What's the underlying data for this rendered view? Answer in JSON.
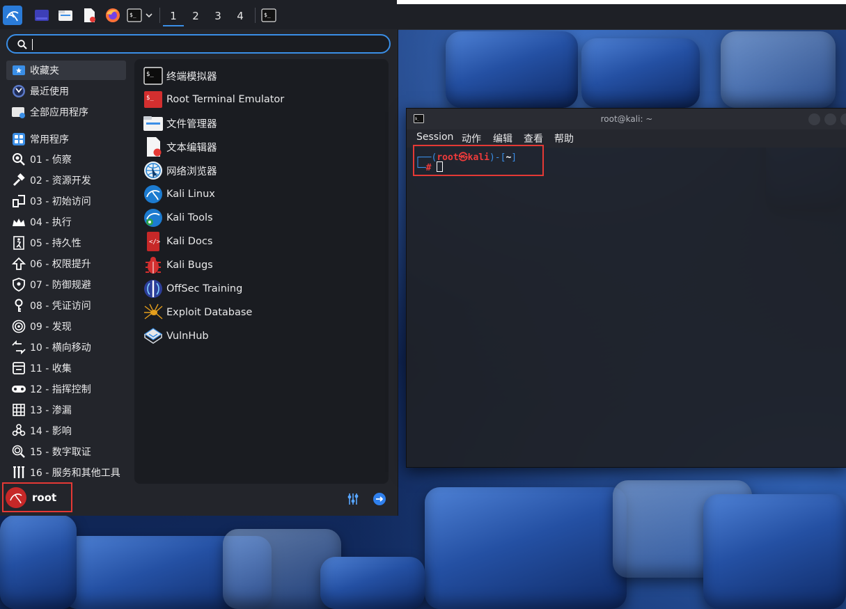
{
  "panel": {
    "workspaces": [
      "1",
      "2",
      "3",
      "4"
    ],
    "active_workspace": "1"
  },
  "menu": {
    "search": {
      "value": "",
      "placeholder": ""
    },
    "categories": [
      {
        "label": "收藏夹",
        "icon": "star-folder-icon"
      },
      {
        "label": "最近使用",
        "icon": "clock-icon"
      },
      {
        "label": "全部应用程序",
        "icon": "apps-folder-icon"
      },
      {
        "label": "常用程序",
        "icon": "grid-icon"
      },
      {
        "label": "01 - 侦察",
        "icon": "magnifier-icon"
      },
      {
        "label": "02 - 资源开发",
        "icon": "hammer-icon"
      },
      {
        "label": "03 - 初始访问",
        "icon": "door-icon"
      },
      {
        "label": "04 - 执行",
        "icon": "crown-icon"
      },
      {
        "label": "05 - 持久性",
        "icon": "runner-icon"
      },
      {
        "label": "06 - 权限提升",
        "icon": "arrow-up-icon"
      },
      {
        "label": "07 - 防御规避",
        "icon": "shield-icon"
      },
      {
        "label": "08 - 凭证访问",
        "icon": "key-icon"
      },
      {
        "label": "09 - 发现",
        "icon": "radar-icon"
      },
      {
        "label": "10 - 横向移动",
        "icon": "arrows-horizontal-icon"
      },
      {
        "label": "11 - 收集",
        "icon": "archive-icon"
      },
      {
        "label": "12 - 指挥控制",
        "icon": "gamepad-icon"
      },
      {
        "label": "13 - 渗漏",
        "icon": "exfil-icon"
      },
      {
        "label": "14 - 影响",
        "icon": "biohazard-icon"
      },
      {
        "label": "15 - 数字取证",
        "icon": "fingerprint-icon"
      },
      {
        "label": "16 - 服务和其他工具",
        "icon": "tools-icon"
      }
    ],
    "apps": [
      {
        "label": "终端模拟器",
        "icon": "terminal-icon"
      },
      {
        "label": "Root Terminal Emulator",
        "icon": "root-terminal-icon"
      },
      {
        "label": "文件管理器",
        "icon": "folder-icon"
      },
      {
        "label": "文本编辑器",
        "icon": "text-editor-icon"
      },
      {
        "label": "网络浏览器",
        "icon": "web-browser-icon"
      },
      {
        "label": "Kali Linux",
        "icon": "kali-dragon-icon"
      },
      {
        "label": "Kali Tools",
        "icon": "kali-tools-icon"
      },
      {
        "label": "Kali Docs",
        "icon": "kali-docs-icon"
      },
      {
        "label": "Kali Bugs",
        "icon": "bug-icon"
      },
      {
        "label": "OffSec Training",
        "icon": "offsec-icon"
      },
      {
        "label": "Exploit Database",
        "icon": "spider-icon"
      },
      {
        "label": "VulnHub",
        "icon": "vulnhub-icon"
      }
    ],
    "user": "root"
  },
  "terminal": {
    "title": "root@kali: ~",
    "menu": [
      "Session",
      "动作",
      "编辑",
      "查看",
      "帮助"
    ],
    "prompt_user": "root",
    "prompt_sym": "㉿",
    "prompt_host": "kali",
    "prompt_dir": "~",
    "prompt_hash": "#"
  },
  "colors": {
    "accent": "#3a8ee6",
    "highlight_box": "#e53935",
    "menu_bg": "#23252b",
    "prompt_red": "#e53935",
    "prompt_blue": "#3a8ee6"
  }
}
